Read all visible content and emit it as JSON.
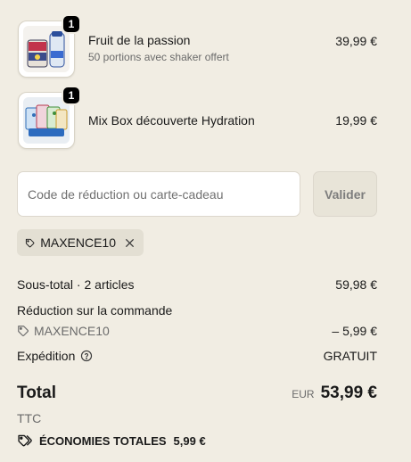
{
  "cart": {
    "items": [
      {
        "qty": "1",
        "name": "Fruit de la passion",
        "subtitle": "50 portions avec shaker offert",
        "price": "39,99 €",
        "image": "product-tub-and-shaker"
      },
      {
        "qty": "1",
        "name": "Mix Box découverte Hydration",
        "price": "19,99 €",
        "image": "mix-box-sachets"
      }
    ]
  },
  "discount": {
    "placeholder": "Code de réduction ou carte-cadeau",
    "apply_label": "Valider",
    "applied_code": "MAXENCE10"
  },
  "summary": {
    "subtotal_label": "Sous-total · 2 articles",
    "subtotal_value": "59,98 €",
    "order_discount_label": "Réduction sur la commande",
    "order_discount_code": "MAXENCE10",
    "order_discount_value": "– 5,99 €",
    "shipping_label": "Expédition",
    "shipping_value": "GRATUIT",
    "total_label": "Total",
    "currency": "EUR",
    "total_value": "53,99 €",
    "tax_note": "TTC",
    "savings_label": "ÉCONOMIES TOTALES",
    "savings_value": "5,99 €"
  },
  "icons": {
    "tag": "tag-icon",
    "remove": "close-icon",
    "help": "help-circle-icon",
    "savings": "tags-icon"
  }
}
